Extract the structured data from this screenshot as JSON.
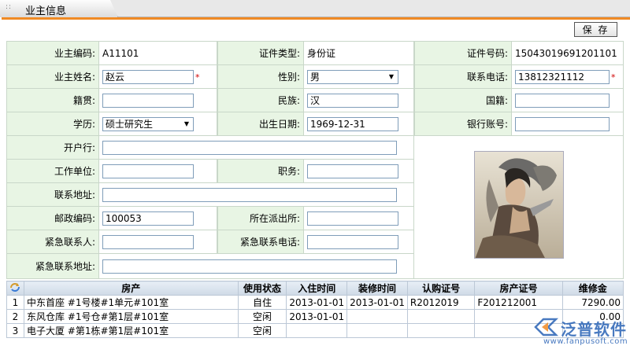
{
  "window": {
    "title": "业主信息"
  },
  "toolbar": {
    "save_label": "保 存"
  },
  "form": {
    "owner_code": {
      "label": "业主编码:",
      "value": "A11101"
    },
    "id_type": {
      "label": "证件类型:",
      "value": "身份证"
    },
    "id_number": {
      "label": "证件号码:",
      "value": "15043019691201101"
    },
    "owner_name": {
      "label": "业主姓名:",
      "value": "赵云"
    },
    "gender": {
      "label": "性别:",
      "value": "男"
    },
    "phone": {
      "label": "联系电话:",
      "value": "13812321112"
    },
    "native_place": {
      "label": "籍贯:",
      "value": ""
    },
    "ethnicity": {
      "label": "民族:",
      "value": "汉"
    },
    "nationality": {
      "label": "国籍:",
      "value": ""
    },
    "education": {
      "label": "学历:",
      "value": "硕士研究生"
    },
    "birth_date": {
      "label": "出生日期:",
      "value": "1969-12-31"
    },
    "bank_account": {
      "label": "银行账号:",
      "value": ""
    },
    "bank": {
      "label": "开户行:",
      "value": ""
    },
    "employer": {
      "label": "工作单位:",
      "value": ""
    },
    "position": {
      "label": "职务:",
      "value": ""
    },
    "address": {
      "label": "联系地址:",
      "value": ""
    },
    "postcode": {
      "label": "邮政编码:",
      "value": "100053"
    },
    "police_station": {
      "label": "所在派出所:",
      "value": ""
    },
    "emergency_contact": {
      "label": "紧急联系人:",
      "value": ""
    },
    "emergency_phone": {
      "label": "紧急联系电话:",
      "value": ""
    },
    "emergency_address": {
      "label": "紧急联系地址:",
      "value": ""
    },
    "required_mark": "*"
  },
  "property_table": {
    "headers": [
      "房产",
      "使用状态",
      "入住时间",
      "装修时间",
      "认购证号",
      "房产证号",
      "维修金"
    ],
    "rows": [
      {
        "no": "1",
        "property": "中东首座 #1号楼#1单元#101室",
        "status": "自住",
        "move_in": "2013-01-01",
        "renovation": "2013-01-01",
        "subscription": "R2012019",
        "certificate": "F201212001",
        "fund": "7290.00"
      },
      {
        "no": "2",
        "property": "东风仓库 #1号仓#第1层#101室",
        "status": "空闲",
        "move_in": "2013-01-01",
        "renovation": "",
        "subscription": "",
        "certificate": "",
        "fund": "0.00"
      },
      {
        "no": "3",
        "property": "电子大厦 #第1栋#第1层#101室",
        "status": "空闲",
        "move_in": "",
        "renovation": "",
        "subscription": "",
        "certificate": "",
        "fund": ""
      }
    ]
  },
  "watermark": {
    "name": "泛普软件",
    "url": "www.fanpusoft.com"
  },
  "colors": {
    "accent": "#f08a24",
    "label_bg": "#e8f5e4",
    "header_bg": "#dbe5ef",
    "watermark": "#2a63b6"
  }
}
